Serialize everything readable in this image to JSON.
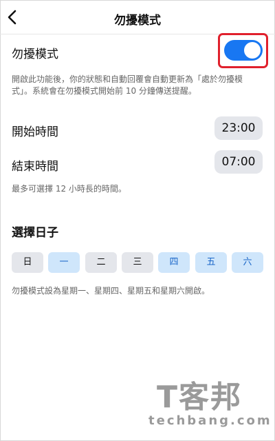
{
  "header": {
    "title": "勿擾模式",
    "back_icon": "chevron-left-icon"
  },
  "dnd": {
    "label": "勿擾模式",
    "enabled": true,
    "toggle_color": "#1877f2",
    "highlight_color": "#e0202c",
    "description_line1": "開啟此功能後，你的狀態和自動回覆會自動更新為「處於勿擾模",
    "description_line2": "式」。系統會在勿擾模式開始前 10 分鐘傳送提醒。"
  },
  "schedule": {
    "start_label": "開始時間",
    "start_value": "23:00",
    "end_label": "結束時間",
    "end_value": "07:00",
    "note": "最多可選擇 12 小時長的時間。"
  },
  "days": {
    "title": "選擇日子",
    "items": [
      {
        "label": "日",
        "selected": false
      },
      {
        "label": "一",
        "selected": true
      },
      {
        "label": "二",
        "selected": false
      },
      {
        "label": "三",
        "selected": false
      },
      {
        "label": "四",
        "selected": true
      },
      {
        "label": "五",
        "selected": true
      },
      {
        "label": "六",
        "selected": true
      }
    ],
    "summary": "勿擾模式設為星期一、星期四、星期五和星期六開啟。"
  },
  "watermark": {
    "brand_cn": "T客邦",
    "brand_en": "techbang.com"
  }
}
